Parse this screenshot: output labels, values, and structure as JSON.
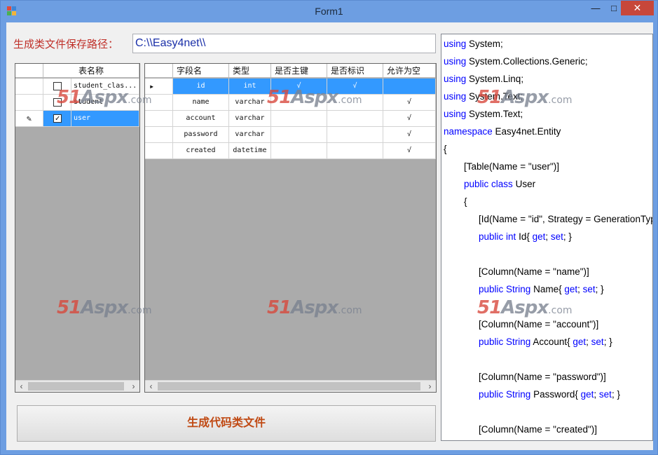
{
  "window": {
    "title": "Form1",
    "min_label": "—",
    "max_label": "□",
    "close_label": "✕"
  },
  "path": {
    "label": "生成类文件保存路径：",
    "value": "C:\\\\Easy4net\\\\"
  },
  "tables_grid": {
    "header": "表名称",
    "rows": [
      {
        "name": "student_clas...",
        "checked": false,
        "selected": false
      },
      {
        "name": "student",
        "checked": false,
        "selected": false
      },
      {
        "name": "user",
        "checked": true,
        "selected": true
      }
    ]
  },
  "fields_grid": {
    "headers": [
      "字段名",
      "类型",
      "是否主键",
      "是否标识",
      "允许为空"
    ],
    "rows": [
      {
        "name": "id",
        "type": "int",
        "pk": "√",
        "identity": "√",
        "nullable": ""
      },
      {
        "name": "name",
        "type": "varchar",
        "pk": "",
        "identity": "",
        "nullable": "√"
      },
      {
        "name": "account",
        "type": "varchar",
        "pk": "",
        "identity": "",
        "nullable": "√"
      },
      {
        "name": "password",
        "type": "varchar",
        "pk": "",
        "identity": "",
        "nullable": "√"
      },
      {
        "name": "created",
        "type": "datetime",
        "pk": "",
        "identity": "",
        "nullable": "√"
      }
    ]
  },
  "generate_button": "生成代码类文件",
  "code_lines": [
    [
      {
        "k": 1,
        "t": "using"
      },
      {
        "t": " System;"
      }
    ],
    [
      {
        "k": 1,
        "t": "using"
      },
      {
        "t": " System.Collections.Generic;"
      }
    ],
    [
      {
        "k": 1,
        "t": "using"
      },
      {
        "t": " System.Linq;"
      }
    ],
    [
      {
        "k": 1,
        "t": "using"
      },
      {
        "t": " System.Text;"
      }
    ],
    [
      {
        "k": 1,
        "t": "using"
      },
      {
        "t": " System.Text;"
      }
    ],
    [
      {
        "k": 1,
        "t": "namespace"
      },
      {
        "t": " Easy4net.Entity"
      }
    ],
    [
      {
        "t": "{"
      }
    ],
    [
      {
        "t": "[Table(Name = \"user\")]"
      }
    ],
    [
      {
        "k": 1,
        "t": "public"
      },
      {
        "t": " "
      },
      {
        "k": 1,
        "t": "class"
      },
      {
        "t": " User"
      }
    ],
    [
      {
        "t": "{"
      }
    ],
    [
      {
        "t": "[Id(Name = \"id\", Strategy = GenerationType"
      }
    ],
    [
      {
        "k": 1,
        "t": "public"
      },
      {
        "t": " "
      },
      {
        "k": 1,
        "t": "int"
      },
      {
        "t": " Id{ "
      },
      {
        "k": 1,
        "t": "get"
      },
      {
        "t": "; "
      },
      {
        "k": 1,
        "t": "set"
      },
      {
        "t": "; }"
      }
    ],
    [
      {
        "t": ""
      }
    ],
    [
      {
        "t": "[Column(Name = \"name\")]"
      }
    ],
    [
      {
        "k": 1,
        "t": "public"
      },
      {
        "t": " "
      },
      {
        "k": 1,
        "t": "String"
      },
      {
        "t": " Name{ "
      },
      {
        "k": 1,
        "t": "get"
      },
      {
        "t": "; "
      },
      {
        "k": 1,
        "t": "set"
      },
      {
        "t": "; }"
      }
    ],
    [
      {
        "t": ""
      }
    ],
    [
      {
        "t": "[Column(Name = \"account\")]"
      }
    ],
    [
      {
        "k": 1,
        "t": "public"
      },
      {
        "t": " "
      },
      {
        "k": 1,
        "t": "String"
      },
      {
        "t": " Account{ "
      },
      {
        "k": 1,
        "t": "get"
      },
      {
        "t": "; "
      },
      {
        "k": 1,
        "t": "set"
      },
      {
        "t": "; }"
      }
    ],
    [
      {
        "t": ""
      }
    ],
    [
      {
        "t": "[Column(Name = \"password\")]"
      }
    ],
    [
      {
        "k": 1,
        "t": "public"
      },
      {
        "t": " "
      },
      {
        "k": 1,
        "t": "String"
      },
      {
        "t": " Password{ "
      },
      {
        "k": 1,
        "t": "get"
      },
      {
        "t": "; "
      },
      {
        "k": 1,
        "t": "set"
      },
      {
        "t": "; }"
      }
    ],
    [
      {
        "t": ""
      }
    ],
    [
      {
        "t": "[Column(Name = \"created\")]"
      }
    ]
  ],
  "watermark": {
    "num": "51",
    "brand": "Aspx",
    "suffix": ".com"
  },
  "icons": {
    "app": "app-icon",
    "row_selector": "triangle-right-icon",
    "edit": "pencil-icon"
  }
}
